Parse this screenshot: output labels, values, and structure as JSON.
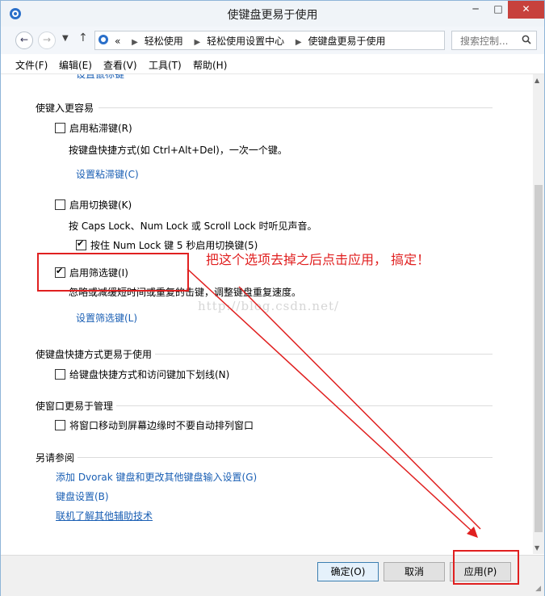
{
  "window": {
    "title": "使键盘更易于使用",
    "minimize": "─",
    "maximize": "□",
    "close": "✕"
  },
  "address": {
    "overflow": "«",
    "breadcrumbs": [
      "轻松使用",
      "轻松使用设置中心",
      "使键盘更易于使用"
    ],
    "search_placeholder": "搜索控制..."
  },
  "menu": [
    "文件(F)",
    "编辑(E)",
    "查看(V)",
    "工具(T)",
    "帮助(H)"
  ],
  "sections": {
    "easier_typing": {
      "heading": "使键入更容易",
      "sticky_keys": {
        "label": "启用粘滞键(R)",
        "checked": false,
        "desc": "按键盘快捷方式(如 Ctrl+Alt+Del)，一次一个键。",
        "link": "设置粘滞键(C)"
      },
      "toggle_keys": {
        "label": "启用切换键(K)",
        "checked": false,
        "desc": "按 Caps Lock、Num Lock 或 Scroll Lock 时听见声音。",
        "sub_label": "按住 Num Lock 键 5 秒启用切换键(5)",
        "sub_checked": true
      },
      "filter_keys": {
        "label": "启用筛选键(I)",
        "checked": true,
        "desc": "忽略或减缓短时间或重复的击键，调整键盘重复速度。",
        "link": "设置筛选键(L)"
      }
    },
    "shortcuts": {
      "heading": "使键盘快捷方式更易于使用",
      "underline_label": "给键盘快捷方式和访问键加下划线(N)",
      "underline_checked": false
    },
    "windows": {
      "heading": "使窗口更易于管理",
      "snap_label": "将窗口移动到屏幕边缘时不要自动排列窗口",
      "snap_checked": false
    },
    "see_also": {
      "heading": "另请参阅",
      "links": [
        "添加 Dvorak 键盘和更改其他键盘输入设置(G)",
        "键盘设置(B)",
        "联机了解其他辅助技术"
      ]
    }
  },
  "watermark": "http://blog.csdn.net/",
  "annotation": {
    "text": "把这个选项去掉之后点击应用， 搞定！",
    "color": "#e02020"
  },
  "buttons": {
    "ok": "确定(O)",
    "cancel": "取消",
    "apply": "应用(P)"
  }
}
